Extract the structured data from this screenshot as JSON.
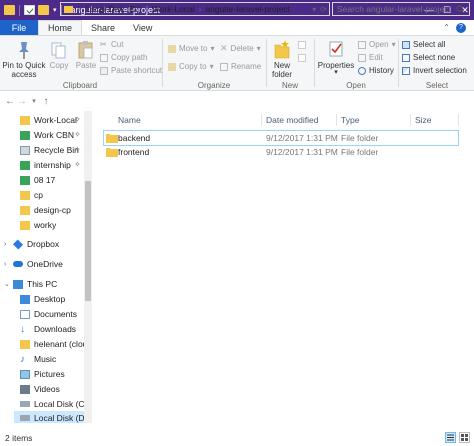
{
  "window": {
    "title": "angular-laravel-project",
    "controls": {
      "minimize": "—",
      "maximize": "☐",
      "close": "✕"
    }
  },
  "ribbon_tabs": {
    "file": "File",
    "home": "Home",
    "share": "Share",
    "view": "View"
  },
  "ribbon": {
    "clipboard": {
      "label": "Clipboard",
      "pin_to_quick_access": "Pin to Quick access",
      "copy": "Copy",
      "paste": "Paste",
      "cut": "Cut",
      "copy_path": "Copy path",
      "paste_shortcut": "Paste shortcut"
    },
    "organize": {
      "label": "Organize",
      "move_to": "Move to",
      "copy_to": "Copy to",
      "delete": "Delete",
      "rename": "Rename"
    },
    "new": {
      "label": "New",
      "new_folder": "New folder"
    },
    "open": {
      "label": "Open",
      "properties": "Properties",
      "open": "Open",
      "edit": "Edit",
      "history": "History"
    },
    "select": {
      "label": "Select",
      "select_all": "Select all",
      "select_none": "Select none",
      "invert_selection": "Invert selection"
    }
  },
  "address_bar": {
    "prefix": "«",
    "crumbs": [
      "Local Disk (D:)",
      "Work-Local",
      "angular-laravel-project"
    ],
    "search_placeholder": "Search angular-laravel-project"
  },
  "nav_pane": {
    "quick_access": [
      {
        "label": "Work-Local",
        "pinned": true
      },
      {
        "label": "Work CBN",
        "pinned": true
      },
      {
        "label": "Recycle Bin",
        "pinned": true
      },
      {
        "label": "internship",
        "pinned": true
      },
      {
        "label": "08 17",
        "pinned": false
      },
      {
        "label": "cp",
        "pinned": false
      },
      {
        "label": "design-cp",
        "pinned": false
      },
      {
        "label": "worky",
        "pinned": false
      }
    ],
    "dropbox": "Dropbox",
    "onedrive": "OneDrive",
    "this_pc": "This PC",
    "this_pc_items": [
      {
        "label": "Desktop",
        "icon": "desktop-icon"
      },
      {
        "label": "Documents",
        "icon": "documents-icon"
      },
      {
        "label": "Downloads",
        "icon": "downloads-icon"
      },
      {
        "label": "helenant (clou",
        "icon": "user-folder-icon"
      },
      {
        "label": "Music",
        "icon": "music-icon"
      },
      {
        "label": "Pictures",
        "icon": "pictures-icon"
      },
      {
        "label": "Videos",
        "icon": "videos-icon"
      },
      {
        "label": "Local Disk (C:)",
        "icon": "drive-icon"
      },
      {
        "label": "Local Disk (D:)",
        "icon": "drive-icon",
        "selected": true
      }
    ]
  },
  "file_list": {
    "columns": [
      "Name",
      "Date modified",
      "Type",
      "Size"
    ],
    "rows": [
      {
        "name": "backend",
        "date": "9/12/2017 1:31 PM",
        "type": "File folder",
        "size": ""
      },
      {
        "name": "frontend",
        "date": "9/12/2017 1:31 PM",
        "type": "File folder",
        "size": ""
      }
    ]
  },
  "status_bar": {
    "item_count": "2 items"
  },
  "colors": {
    "titlebar": "#4b2a8a",
    "file_tab": "#1e64c8",
    "selection": "#cce8ff",
    "folder": "#f3c84a"
  }
}
